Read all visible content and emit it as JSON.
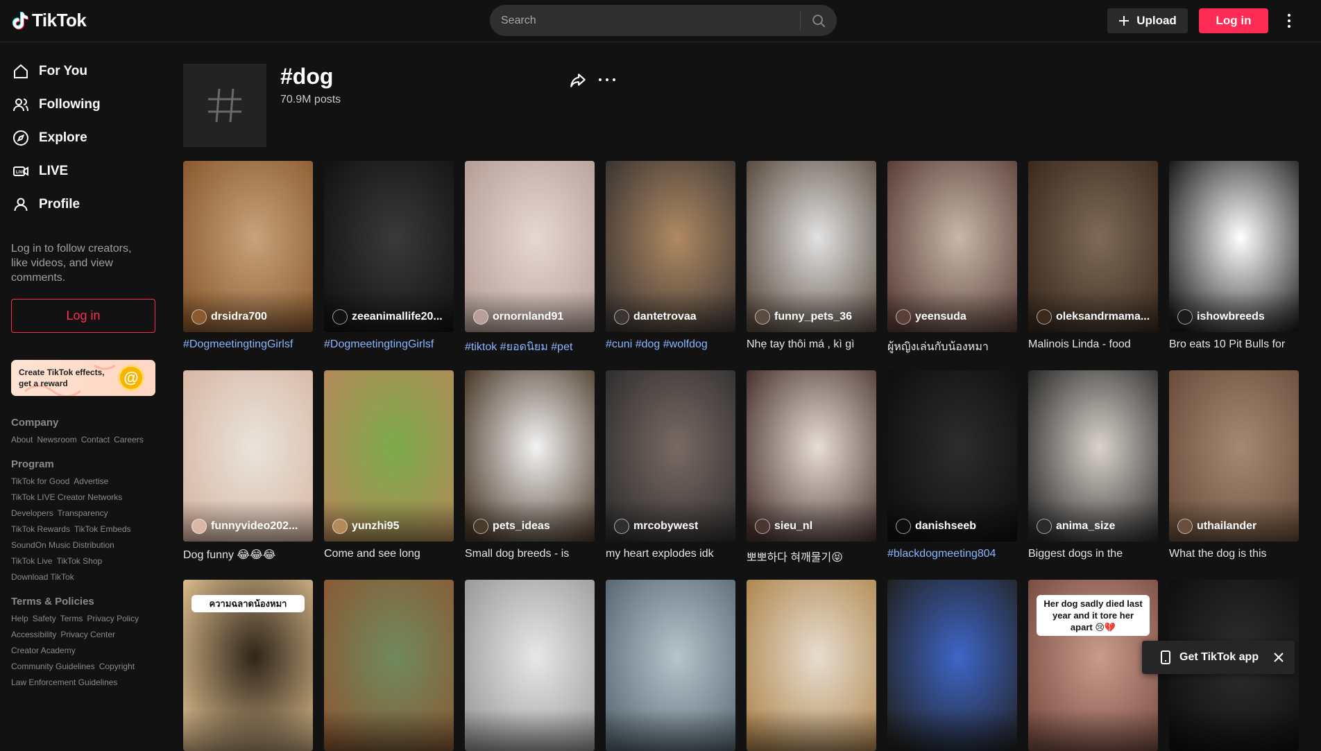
{
  "header": {
    "logo_text": "TikTok",
    "search_placeholder": "Search",
    "upload_label": "Upload",
    "login_label": "Log in"
  },
  "sidebar": {
    "nav": [
      {
        "label": "For You",
        "icon": "home-icon"
      },
      {
        "label": "Following",
        "icon": "following-icon"
      },
      {
        "label": "Explore",
        "icon": "compass-icon"
      },
      {
        "label": "LIVE",
        "icon": "live-icon"
      },
      {
        "label": "Profile",
        "icon": "profile-icon"
      }
    ],
    "login_prompt": "Log in to follow creators, like videos, and view comments.",
    "login_label": "Log in",
    "effects_text": "Create TikTok effects, get a reward",
    "footer": {
      "company_heading": "Company",
      "company_links": [
        "About",
        "Newsroom",
        "Contact",
        "Careers"
      ],
      "program_heading": "Program",
      "program_rows": [
        [
          "TikTok for Good",
          "Advertise"
        ],
        [
          "TikTok LIVE Creator Networks"
        ],
        [
          "Developers",
          "Transparency"
        ],
        [
          "TikTok Rewards",
          "TikTok Embeds"
        ],
        [
          "SoundOn Music Distribution"
        ],
        [
          "TikTok Live",
          "TikTok Shop"
        ],
        [
          "Download TikTok"
        ]
      ],
      "terms_heading": "Terms & Policies",
      "terms_rows": [
        [
          "Help",
          "Safety",
          "Terms",
          "Privacy Policy"
        ],
        [
          "Accessibility",
          "Privacy Center"
        ],
        [
          "Creator Academy"
        ],
        [
          "Community Guidelines",
          "Copyright"
        ],
        [
          "Law Enforcement Guidelines"
        ]
      ]
    }
  },
  "tag": {
    "title": "#dog",
    "count": "70.9M posts"
  },
  "videos": [
    {
      "author": "drsidra700",
      "caption": "#DogmeetingtingGirlsf",
      "hashtag": true,
      "colors": [
        "#c7a27a",
        "#8a5a2f"
      ]
    },
    {
      "author": "zeeanimallife20...",
      "caption": "#DogmeetingtingGirlsf",
      "hashtag": true,
      "colors": [
        "#3a3a3a",
        "#121212"
      ]
    },
    {
      "author": "ornornland91",
      "caption": "#tiktok #ยอดนิยม #pet",
      "hashtag": true,
      "colors": [
        "#e7d7d2",
        "#b59f98"
      ]
    },
    {
      "author": "dantetrovaa",
      "caption": "#cuni #dog #wolfdog",
      "hashtag": true,
      "colors": [
        "#b08a62",
        "#3b3533"
      ]
    },
    {
      "author": "funny_pets_36",
      "caption": "Nhẹ tay thôi má , kì gì",
      "hashtag": false,
      "colors": [
        "#e2e2e2",
        "#5a4c40"
      ]
    },
    {
      "author": "yeensuda",
      "caption": "ผู้หญิงเล่นกับน้องหมา",
      "hashtag": false,
      "colors": [
        "#c7b8aa",
        "#5b3e38"
      ]
    },
    {
      "author": "oleksandrmama...",
      "caption": "Malinois Linda - food",
      "hashtag": false,
      "colors": [
        "#7e6a58",
        "#3a2a1e"
      ]
    },
    {
      "author": "ishowbreeds",
      "caption": "Bro eats 10 Pit Bulls for",
      "hashtag": false,
      "colors": [
        "#ffffff",
        "#1b1b1b"
      ]
    },
    {
      "author": "funnyvideo202...",
      "caption": "Dog funny 😂😂😂",
      "hashtag": false,
      "colors": [
        "#e9e4db",
        "#d8b7a4"
      ]
    },
    {
      "author": "yunzhi95",
      "caption": "Come and see long",
      "hashtag": false,
      "colors": [
        "#7bab4a",
        "#b58a5a"
      ]
    },
    {
      "author": "pets_ideas",
      "caption": "Small dog breeds - is",
      "hashtag": false,
      "colors": [
        "#f3f3f3",
        "#4a3a2a"
      ]
    },
    {
      "author": "mrcobywest",
      "caption": "my heart explodes idk",
      "hashtag": false,
      "colors": [
        "#7a6a64",
        "#2f2f2f"
      ]
    },
    {
      "author": "sieu_nl",
      "caption": "뽀뽀하다 혀깨물기😝",
      "hashtag": false,
      "colors": [
        "#e8ddd6",
        "#4a3530"
      ]
    },
    {
      "author": "danishseeb",
      "caption": "#blackdogmeeting804",
      "hashtag": true,
      "colors": [
        "#2d2d2d",
        "#0e0e0e"
      ]
    },
    {
      "author": "anima_size",
      "caption": "Biggest dogs in the",
      "hashtag": false,
      "colors": [
        "#d9d3cc",
        "#2a2a2a"
      ]
    },
    {
      "author": "uthailander",
      "caption": "What the dog is this",
      "hashtag": false,
      "colors": [
        "#a48a72",
        "#6a4d3b"
      ]
    },
    {
      "author": "",
      "caption": "",
      "hashtag": false,
      "colors": [
        "#2f2519",
        "#d8b98a"
      ],
      "overlay": "ความฉลาดน้องหมา"
    },
    {
      "author": "",
      "caption": "",
      "hashtag": false,
      "colors": [
        "#6f8a5c",
        "#8a5a36"
      ]
    },
    {
      "author": "",
      "caption": "",
      "hashtag": false,
      "colors": [
        "#e7e7e7",
        "#9a9a9a"
      ]
    },
    {
      "author": "",
      "caption": "",
      "hashtag": false,
      "colors": [
        "#b6c4cc",
        "#5a6a74"
      ]
    },
    {
      "author": "",
      "caption": "",
      "hashtag": false,
      "colors": [
        "#e7ddcf",
        "#b08850"
      ]
    },
    {
      "author": "",
      "caption": "",
      "hashtag": false,
      "colors": [
        "#3d66c7",
        "#222"
      ]
    },
    {
      "author": "",
      "caption": "",
      "hashtag": false,
      "colors": [
        "#c99b8a",
        "#7a4e44"
      ],
      "overlay": "Her dog sadly died last year and it tore her apart 😢💔"
    },
    {
      "author": "",
      "caption": "",
      "hashtag": false,
      "colors": [
        "#2f2f2f",
        "#0f0f0f"
      ]
    }
  ],
  "get_app": {
    "label": "Get TikTok app"
  },
  "colors": {
    "accent": "#fe2c55",
    "background": "#121212",
    "hashtag": "#8bb4ff"
  }
}
